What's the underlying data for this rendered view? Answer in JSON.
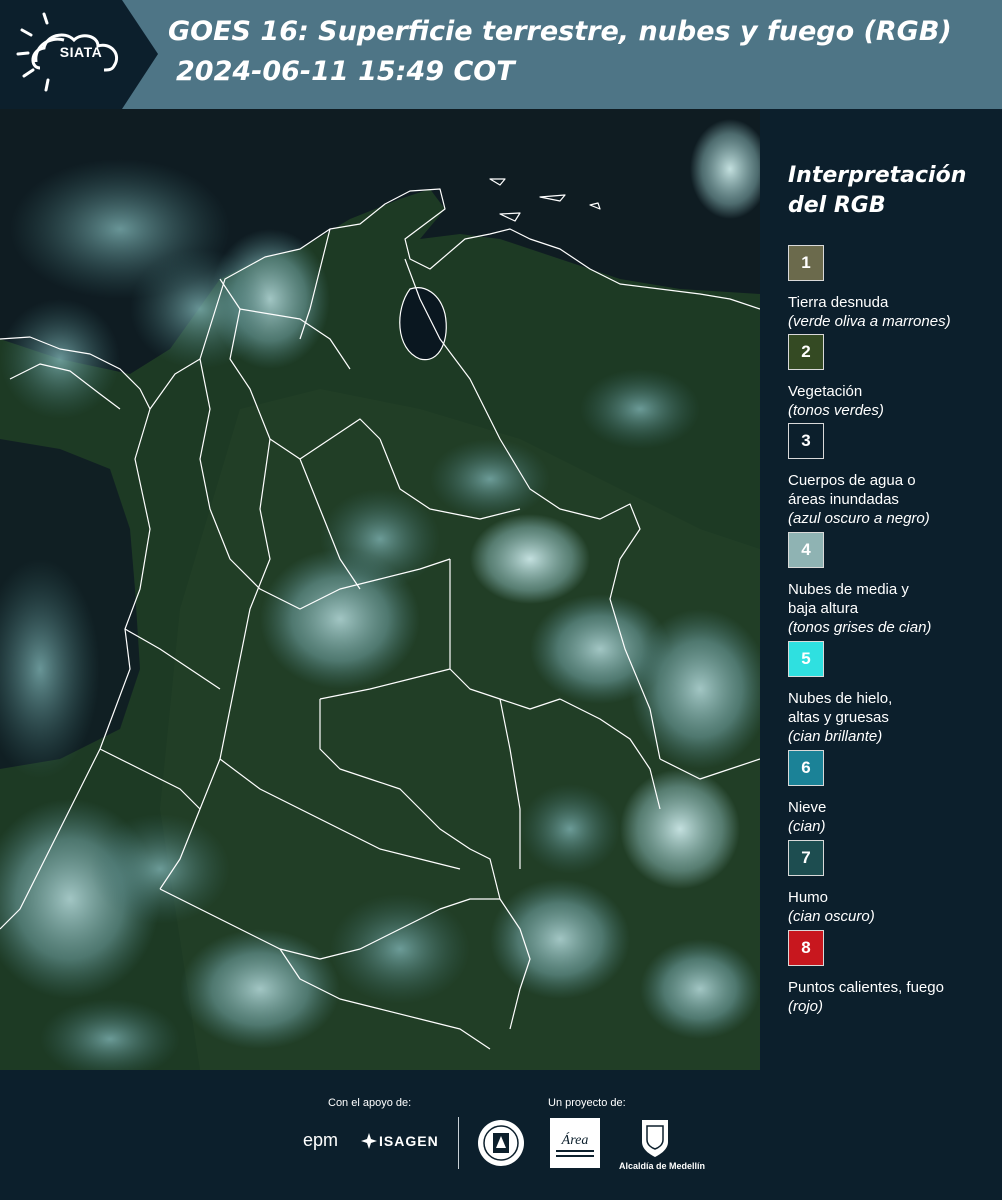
{
  "header": {
    "title": "GOES 16: Superficie terrestre, nubes y fuego (RGB)",
    "datetime": "2024-06-11 15:49 COT",
    "logo_text": "SIATA",
    "background_color": "#4e7586",
    "logo_background_color": "#0c1f2c"
  },
  "legend": {
    "title": "Interpretación del RGB",
    "items": [
      {
        "number": "1",
        "name": "Tierra desnuda",
        "desc": "(verde oliva a marrones)",
        "color": "#6b6a4c"
      },
      {
        "number": "2",
        "name": "Vegetación",
        "desc": "(tonos verdes)",
        "color": "#344a23"
      },
      {
        "number": "3",
        "name": "Cuerpos de agua o\náreas inundadas",
        "desc": "(azul oscuro a negro)",
        "color": "#0c1f2c"
      },
      {
        "number": "4",
        "name": "Nubes de media y\nbaja altura",
        "desc": "(tonos grises de cian)",
        "color": "#8fb3b3"
      },
      {
        "number": "5",
        "name": "Nubes de hielo,\naltas y gruesas",
        "desc": "(cian brillante)",
        "color": "#2fe0e0"
      },
      {
        "number": "6",
        "name": "Nieve",
        "desc": "(cian)",
        "color": "#1b8297"
      },
      {
        "number": "7",
        "name": "Humo",
        "desc": "(cian oscuro)",
        "color": "#1d4d50"
      },
      {
        "number": "8",
        "name": "Puntos calientes, fuego",
        "desc": "(rojo)",
        "color": "#c8171e"
      }
    ]
  },
  "footer": {
    "support_label": "Con el apoyo de:",
    "project_label": "Un proyecto de:",
    "sponsors": [
      "epm",
      "ISAGEN"
    ],
    "area_label": "Área",
    "alcaldia_label": "Alcaldía de Medellín"
  },
  "map": {
    "description_colors": {
      "land": "#1f3a25",
      "cloud": "#8fb8b8",
      "water": "#0d1a24",
      "borders": "#ffffff"
    }
  }
}
